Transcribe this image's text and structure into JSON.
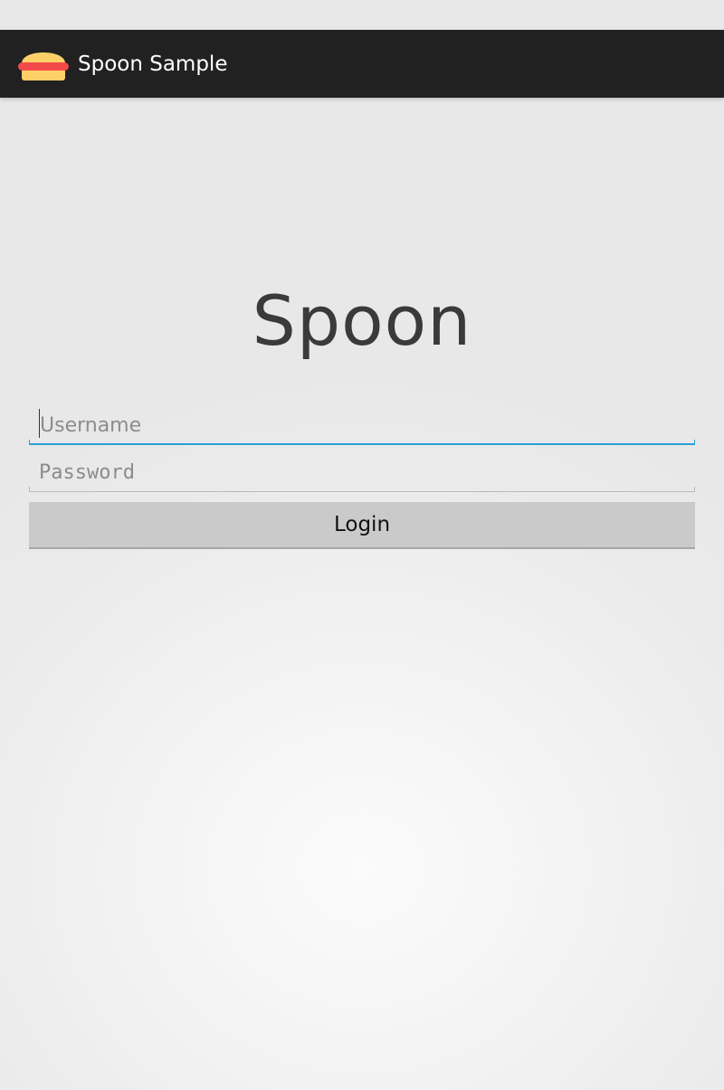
{
  "app": {
    "title": "Spoon Sample",
    "icon": "burger-icon"
  },
  "main": {
    "heading": "Spoon",
    "username": {
      "value": "",
      "placeholder": "Username",
      "focused": true,
      "accent_color": "#2a9fd6"
    },
    "password": {
      "value": "",
      "placeholder": "Password"
    },
    "login_button": {
      "label": "Login"
    }
  },
  "colors": {
    "action_bar": "#212121",
    "bun": "#ffd068",
    "filling": "#f24a4a"
  }
}
